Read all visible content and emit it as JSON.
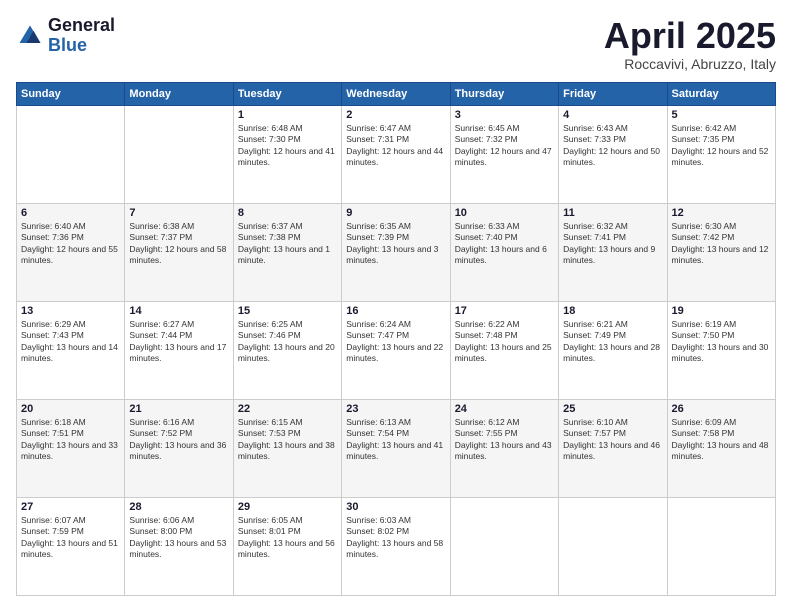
{
  "header": {
    "logo_general": "General",
    "logo_blue": "Blue",
    "month": "April 2025",
    "location": "Roccavivi, Abruzzo, Italy"
  },
  "weekdays": [
    "Sunday",
    "Monday",
    "Tuesday",
    "Wednesday",
    "Thursday",
    "Friday",
    "Saturday"
  ],
  "weeks": [
    [
      {
        "day": "",
        "sunrise": "",
        "sunset": "",
        "daylight": ""
      },
      {
        "day": "",
        "sunrise": "",
        "sunset": "",
        "daylight": ""
      },
      {
        "day": "1",
        "sunrise": "Sunrise: 6:48 AM",
        "sunset": "Sunset: 7:30 PM",
        "daylight": "Daylight: 12 hours and 41 minutes."
      },
      {
        "day": "2",
        "sunrise": "Sunrise: 6:47 AM",
        "sunset": "Sunset: 7:31 PM",
        "daylight": "Daylight: 12 hours and 44 minutes."
      },
      {
        "day": "3",
        "sunrise": "Sunrise: 6:45 AM",
        "sunset": "Sunset: 7:32 PM",
        "daylight": "Daylight: 12 hours and 47 minutes."
      },
      {
        "day": "4",
        "sunrise": "Sunrise: 6:43 AM",
        "sunset": "Sunset: 7:33 PM",
        "daylight": "Daylight: 12 hours and 50 minutes."
      },
      {
        "day": "5",
        "sunrise": "Sunrise: 6:42 AM",
        "sunset": "Sunset: 7:35 PM",
        "daylight": "Daylight: 12 hours and 52 minutes."
      }
    ],
    [
      {
        "day": "6",
        "sunrise": "Sunrise: 6:40 AM",
        "sunset": "Sunset: 7:36 PM",
        "daylight": "Daylight: 12 hours and 55 minutes."
      },
      {
        "day": "7",
        "sunrise": "Sunrise: 6:38 AM",
        "sunset": "Sunset: 7:37 PM",
        "daylight": "Daylight: 12 hours and 58 minutes."
      },
      {
        "day": "8",
        "sunrise": "Sunrise: 6:37 AM",
        "sunset": "Sunset: 7:38 PM",
        "daylight": "Daylight: 13 hours and 1 minute."
      },
      {
        "day": "9",
        "sunrise": "Sunrise: 6:35 AM",
        "sunset": "Sunset: 7:39 PM",
        "daylight": "Daylight: 13 hours and 3 minutes."
      },
      {
        "day": "10",
        "sunrise": "Sunrise: 6:33 AM",
        "sunset": "Sunset: 7:40 PM",
        "daylight": "Daylight: 13 hours and 6 minutes."
      },
      {
        "day": "11",
        "sunrise": "Sunrise: 6:32 AM",
        "sunset": "Sunset: 7:41 PM",
        "daylight": "Daylight: 13 hours and 9 minutes."
      },
      {
        "day": "12",
        "sunrise": "Sunrise: 6:30 AM",
        "sunset": "Sunset: 7:42 PM",
        "daylight": "Daylight: 13 hours and 12 minutes."
      }
    ],
    [
      {
        "day": "13",
        "sunrise": "Sunrise: 6:29 AM",
        "sunset": "Sunset: 7:43 PM",
        "daylight": "Daylight: 13 hours and 14 minutes."
      },
      {
        "day": "14",
        "sunrise": "Sunrise: 6:27 AM",
        "sunset": "Sunset: 7:44 PM",
        "daylight": "Daylight: 13 hours and 17 minutes."
      },
      {
        "day": "15",
        "sunrise": "Sunrise: 6:25 AM",
        "sunset": "Sunset: 7:46 PM",
        "daylight": "Daylight: 13 hours and 20 minutes."
      },
      {
        "day": "16",
        "sunrise": "Sunrise: 6:24 AM",
        "sunset": "Sunset: 7:47 PM",
        "daylight": "Daylight: 13 hours and 22 minutes."
      },
      {
        "day": "17",
        "sunrise": "Sunrise: 6:22 AM",
        "sunset": "Sunset: 7:48 PM",
        "daylight": "Daylight: 13 hours and 25 minutes."
      },
      {
        "day": "18",
        "sunrise": "Sunrise: 6:21 AM",
        "sunset": "Sunset: 7:49 PM",
        "daylight": "Daylight: 13 hours and 28 minutes."
      },
      {
        "day": "19",
        "sunrise": "Sunrise: 6:19 AM",
        "sunset": "Sunset: 7:50 PM",
        "daylight": "Daylight: 13 hours and 30 minutes."
      }
    ],
    [
      {
        "day": "20",
        "sunrise": "Sunrise: 6:18 AM",
        "sunset": "Sunset: 7:51 PM",
        "daylight": "Daylight: 13 hours and 33 minutes."
      },
      {
        "day": "21",
        "sunrise": "Sunrise: 6:16 AM",
        "sunset": "Sunset: 7:52 PM",
        "daylight": "Daylight: 13 hours and 36 minutes."
      },
      {
        "day": "22",
        "sunrise": "Sunrise: 6:15 AM",
        "sunset": "Sunset: 7:53 PM",
        "daylight": "Daylight: 13 hours and 38 minutes."
      },
      {
        "day": "23",
        "sunrise": "Sunrise: 6:13 AM",
        "sunset": "Sunset: 7:54 PM",
        "daylight": "Daylight: 13 hours and 41 minutes."
      },
      {
        "day": "24",
        "sunrise": "Sunrise: 6:12 AM",
        "sunset": "Sunset: 7:55 PM",
        "daylight": "Daylight: 13 hours and 43 minutes."
      },
      {
        "day": "25",
        "sunrise": "Sunrise: 6:10 AM",
        "sunset": "Sunset: 7:57 PM",
        "daylight": "Daylight: 13 hours and 46 minutes."
      },
      {
        "day": "26",
        "sunrise": "Sunrise: 6:09 AM",
        "sunset": "Sunset: 7:58 PM",
        "daylight": "Daylight: 13 hours and 48 minutes."
      }
    ],
    [
      {
        "day": "27",
        "sunrise": "Sunrise: 6:07 AM",
        "sunset": "Sunset: 7:59 PM",
        "daylight": "Daylight: 13 hours and 51 minutes."
      },
      {
        "day": "28",
        "sunrise": "Sunrise: 6:06 AM",
        "sunset": "Sunset: 8:00 PM",
        "daylight": "Daylight: 13 hours and 53 minutes."
      },
      {
        "day": "29",
        "sunrise": "Sunrise: 6:05 AM",
        "sunset": "Sunset: 8:01 PM",
        "daylight": "Daylight: 13 hours and 56 minutes."
      },
      {
        "day": "30",
        "sunrise": "Sunrise: 6:03 AM",
        "sunset": "Sunset: 8:02 PM",
        "daylight": "Daylight: 13 hours and 58 minutes."
      },
      {
        "day": "",
        "sunrise": "",
        "sunset": "",
        "daylight": ""
      },
      {
        "day": "",
        "sunrise": "",
        "sunset": "",
        "daylight": ""
      },
      {
        "day": "",
        "sunrise": "",
        "sunset": "",
        "daylight": ""
      }
    ]
  ]
}
